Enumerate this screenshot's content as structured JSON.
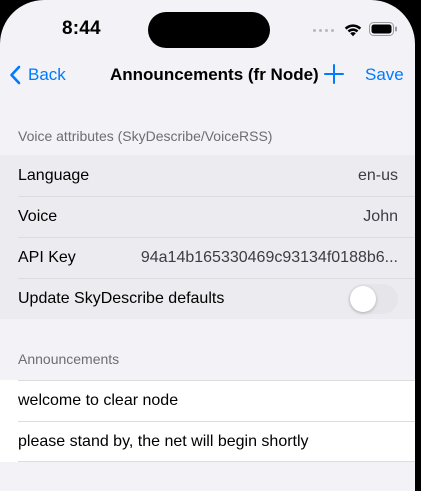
{
  "status_bar": {
    "time": "8:44",
    "icons": [
      "cellular-signal-icon",
      "wifi-icon",
      "battery-icon"
    ]
  },
  "nav": {
    "back_label": "Back",
    "title": "Announcements (fr Node)",
    "save_label": "Save",
    "add_icon": "plus-icon"
  },
  "voice_section": {
    "header": "Voice attributes (SkyDescribe/VoiceRSS)",
    "rows": [
      {
        "label": "Language",
        "value": "en-us"
      },
      {
        "label": "Voice",
        "value": "John"
      },
      {
        "label": "API Key",
        "value": "94a14b165330469c93134f0188b6..."
      }
    ],
    "toggle_row": {
      "label": "Update SkyDescribe defaults",
      "on": false
    }
  },
  "announcements_section": {
    "header": "Announcements",
    "items": [
      "welcome to clear node",
      "please stand by, the net will begin shortly"
    ]
  },
  "colors": {
    "accent": "#007aff",
    "background": "#f2f2f7",
    "group_background": "#ebebf0",
    "secondary_text": "#6d6d72"
  }
}
